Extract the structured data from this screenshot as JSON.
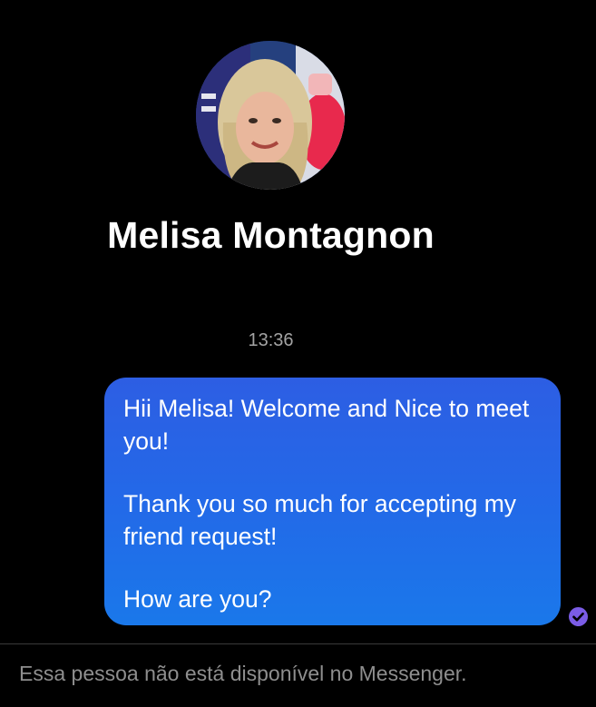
{
  "contact": {
    "name": "Melisa Montagnon",
    "avatar_icon": "profile-photo"
  },
  "conversation": {
    "timestamp": "13:36",
    "messages": [
      {
        "direction": "outgoing",
        "paragraphs": [
          "Hii Melisa! Welcome and Nice to meet you!",
          "Thank you so much for accepting my friend request!",
          "How are you?"
        ],
        "status_icon": "read-check-icon"
      }
    ]
  },
  "footer": {
    "notice": "Essa pessoa não está disponível no Messenger."
  },
  "colors": {
    "background": "#000000",
    "bubble_top": "#2d5ee3",
    "bubble_bottom": "#1a78ea",
    "read_receipt": "#7b5ce6",
    "muted_text": "#8e8e8e"
  }
}
